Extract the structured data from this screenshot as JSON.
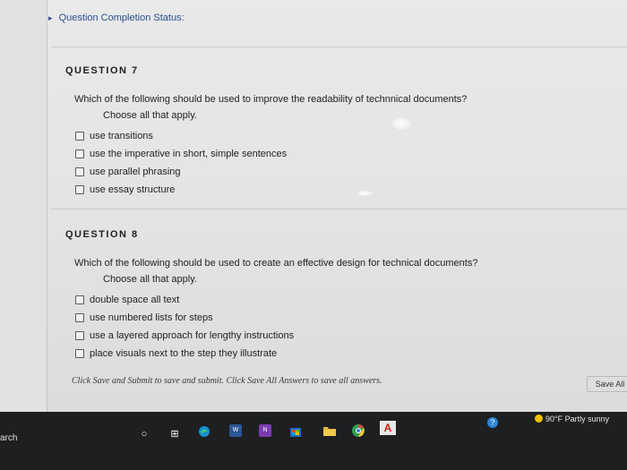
{
  "status": {
    "label": "Question Completion Status:"
  },
  "questions": [
    {
      "header": "QUESTION 7",
      "text": "Which of the following should be used to improve the readability of technnical documents?",
      "instruction": "Choose all that apply.",
      "options": [
        "use transitions",
        "use the imperative in short, simple sentences",
        "use parallel phrasing",
        "use essay structure"
      ]
    },
    {
      "header": "QUESTION 8",
      "text": "Which of the following should be used to create an effective design for technical documents?",
      "instruction": "Choose all that apply.",
      "options": [
        "double space all text",
        "use numbered lists for steps",
        "use a layered approach for lengthy instructions",
        "place visuals next to the step they illustrate"
      ]
    }
  ],
  "footer": {
    "note": "Click Save and Submit to save and submit. Click Save All Answers to save all answers.",
    "save_all_label": "Save All"
  },
  "taskbar": {
    "search_stub": "arch",
    "weather": "90°F  Partly sunny",
    "icons": [
      "circle-icon",
      "task-view-icon",
      "edge-icon",
      "word-icon",
      "onenote-icon",
      "store-icon",
      "folder-icon",
      "chrome-icon",
      "acrobat-icon",
      "help-icon"
    ]
  }
}
